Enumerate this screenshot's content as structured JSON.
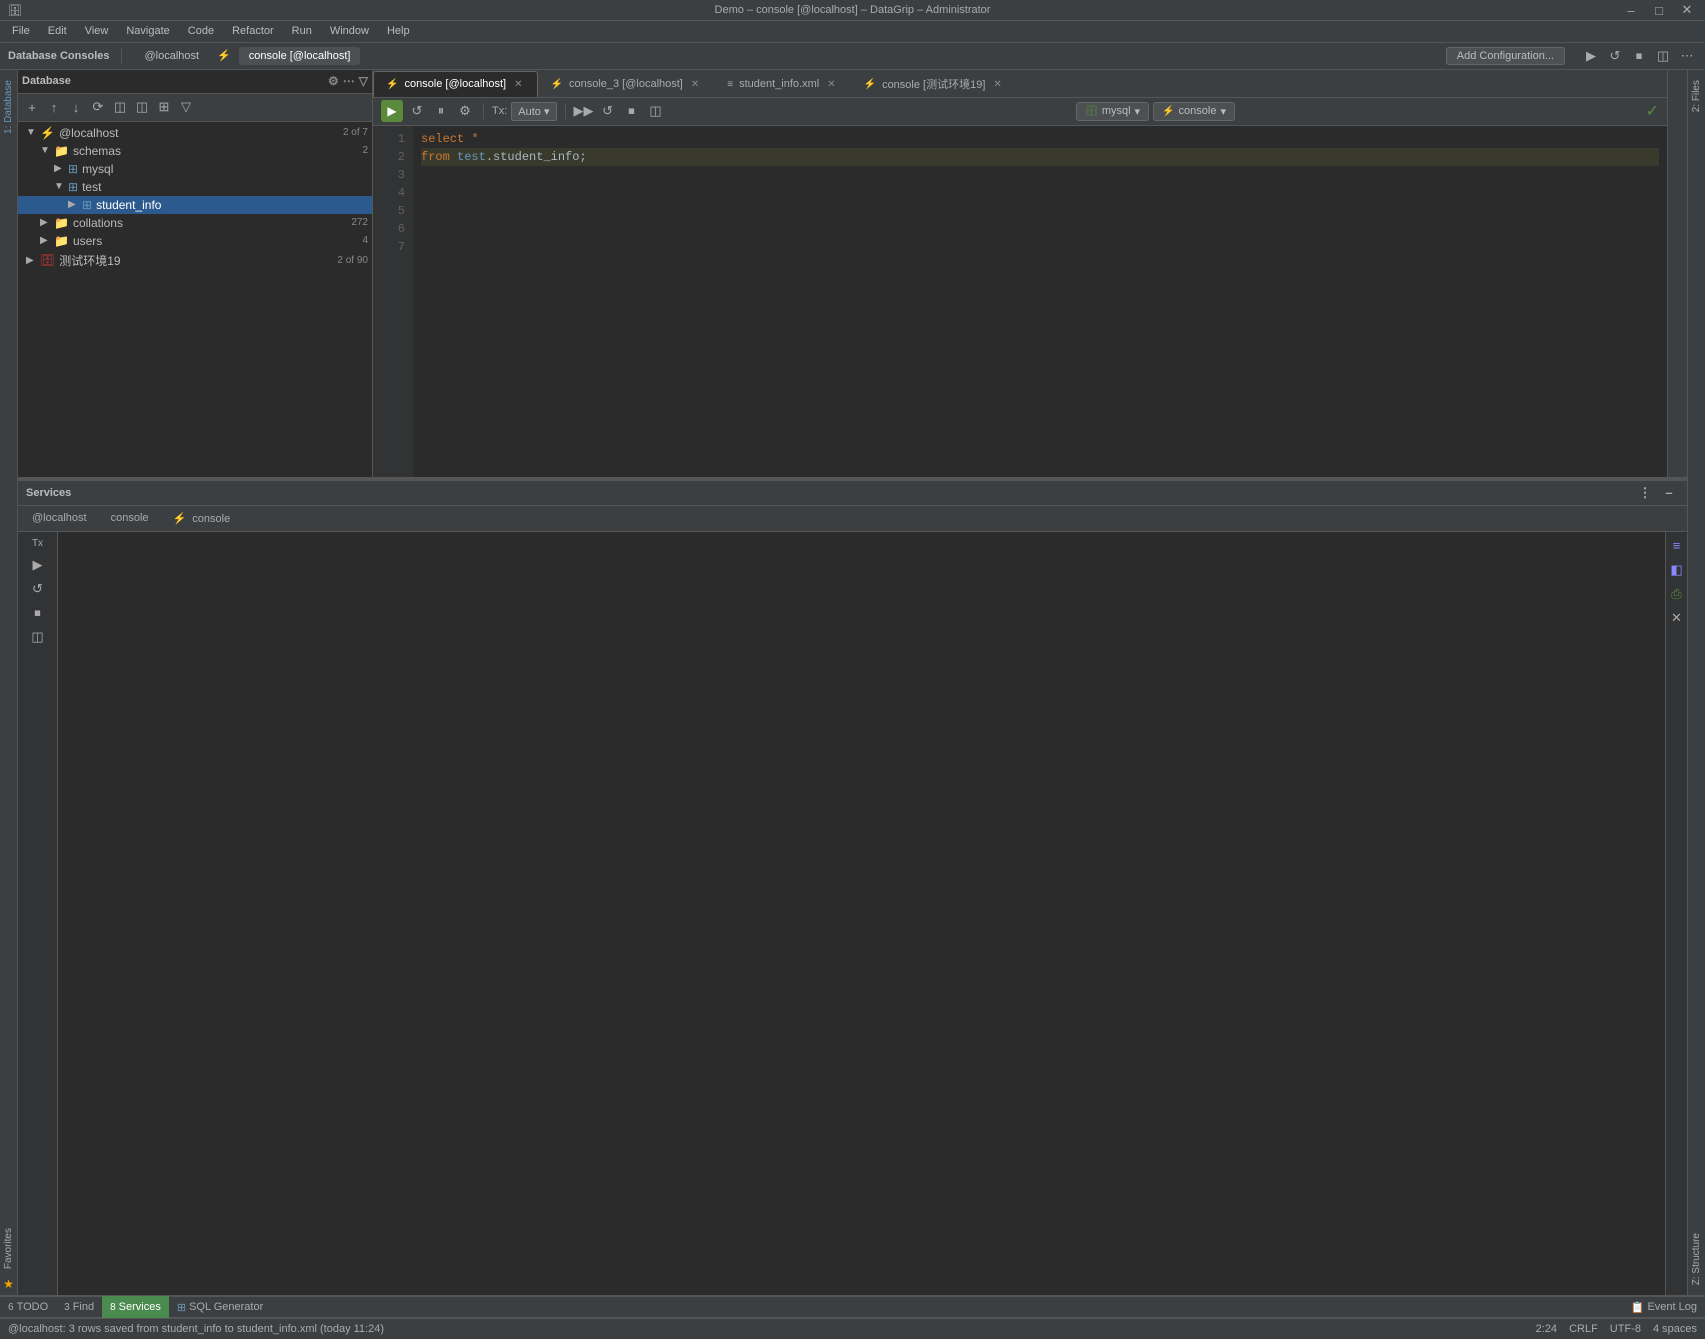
{
  "title_bar": {
    "title": "Demo – console [@localhost] – DataGrip – Administrator",
    "controls": [
      "–",
      "□",
      "✕"
    ]
  },
  "menu_bar": {
    "items": [
      "File",
      "Edit",
      "View",
      "Navigate",
      "Code",
      "Refactor",
      "Run",
      "Window",
      "Help"
    ]
  },
  "db_consoles_bar": {
    "label": "Database Consoles",
    "tabs": [
      {
        "label": "@localhost",
        "active": false
      },
      {
        "label": "console [@localhost]",
        "active": true,
        "icon": "console-icon"
      }
    ],
    "add_config": "Add Configuration...",
    "icons": [
      "▶",
      "↺",
      "⏹",
      "◫",
      "⋯"
    ]
  },
  "sidebar": {
    "header": "Database",
    "toolbar_icons": [
      "+",
      "↑",
      "↓",
      "⟳",
      "✕",
      "◫",
      "◫",
      "⊞",
      "▽"
    ],
    "tree": {
      "root": "@localhost",
      "root_count": "2 of 7",
      "items": [
        {
          "level": 1,
          "type": "folder",
          "label": "schemas",
          "count": "2",
          "expanded": true
        },
        {
          "level": 2,
          "type": "schema",
          "label": "mysql",
          "count": "",
          "expanded": false
        },
        {
          "level": 2,
          "type": "schema",
          "label": "test",
          "count": "",
          "expanded": true
        },
        {
          "level": 3,
          "type": "table",
          "label": "student_info",
          "count": "",
          "selected": true
        },
        {
          "level": 1,
          "type": "folder",
          "label": "collations",
          "count": "272",
          "expanded": false
        },
        {
          "level": 1,
          "type": "folder",
          "label": "users",
          "count": "4",
          "expanded": false
        },
        {
          "level": 0,
          "type": "red-db",
          "label": "测试环境19",
          "count": "2 of 90",
          "expanded": false
        }
      ]
    }
  },
  "editor": {
    "tabs": [
      {
        "label": "console [@localhost]",
        "active": true,
        "closable": true,
        "icon": "console-icon"
      },
      {
        "label": "console_3 [@localhost]",
        "active": false,
        "closable": true,
        "icon": "console-icon"
      },
      {
        "label": "student_info.xml",
        "active": false,
        "closable": true,
        "icon": "xml-icon"
      },
      {
        "label": "console [测试环境19]",
        "active": false,
        "closable": true,
        "icon": "red-console-icon"
      }
    ],
    "toolbar": {
      "run": "▶",
      "icons": [
        "↺",
        "⏸",
        "⚙",
        "▶▶",
        "↺",
        "⏹",
        "◫"
      ],
      "tx_label": "Tx:",
      "tx_value": "Auto",
      "db_selector": "mysql",
      "session_selector": "console"
    },
    "code": {
      "line1": "select *",
      "line2": "from test.student_info;",
      "lines": [
        "1",
        "2",
        "3",
        "4",
        "5",
        "6",
        "7"
      ]
    }
  },
  "services": {
    "header": "Services",
    "header_icons": [
      "⋮",
      "–"
    ],
    "tabs": [
      {
        "label": "@localhost",
        "active": false
      },
      {
        "label": "console",
        "active": false
      },
      {
        "label": "console",
        "active": false,
        "icon": "console-icon"
      }
    ],
    "tx_label": "Tx",
    "left_icons": [
      "▶",
      "↺",
      "⏹",
      "◫"
    ],
    "right_icons": [
      "≡",
      "◧",
      "⎙",
      "✕"
    ]
  },
  "status_bar": {
    "message": "@localhost: 3 rows saved from student_info to student_info.xml (today 11:24)",
    "cursor": "2:24",
    "line_ending": "CRLF",
    "encoding": "UTF-8",
    "indent": "4 spaces",
    "event_log": "Event Log"
  },
  "bottom_tabs": [
    {
      "num": "6",
      "label": "TODO"
    },
    {
      "num": "3",
      "label": "Find"
    },
    {
      "num": "8",
      "label": "Services",
      "active": true
    },
    {
      "label": "SQL Generator"
    }
  ],
  "left_vert": {
    "label1": "1: Database",
    "label2": "Favorites"
  },
  "right_vert": {
    "label1": "2: Files",
    "label2": "Z: Structure"
  }
}
